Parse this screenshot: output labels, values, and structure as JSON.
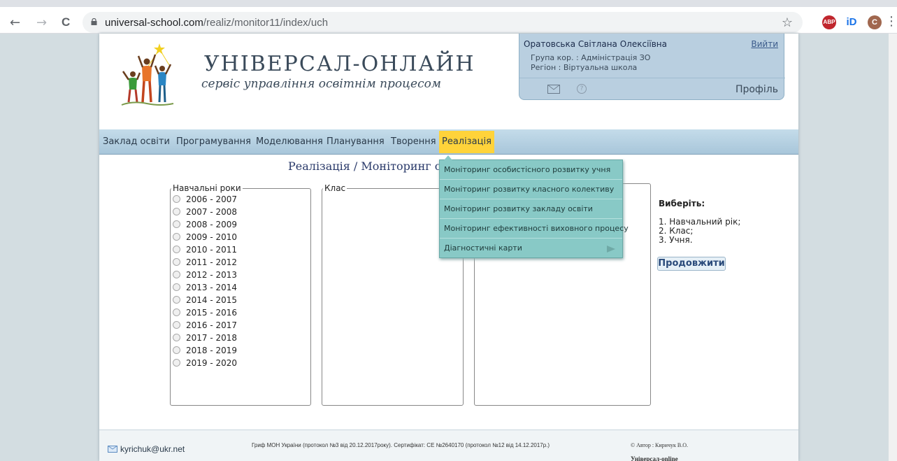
{
  "browser": {
    "url_host": "universal-school.com",
    "url_path": "/realiz/monitor11/index/uch",
    "back": "←",
    "forward": "→",
    "reload": "C",
    "star": "☆",
    "ext_abp": "ABP",
    "ext_id": "iD",
    "avatar": "C",
    "menu": "⋮"
  },
  "header": {
    "brand": "УНІВЕРСАЛ-ОНЛАЙН",
    "tagline": "сервіс управління освітнім процесом"
  },
  "user": {
    "name": "Оратовська Світлана Олексіївна",
    "logout": "Вийти",
    "group": "Група кор. : Адміністрація ЗО",
    "region": "Регіон : Віртуальна школа",
    "help": "?",
    "profile": "Профіль"
  },
  "menu": {
    "items": [
      "Заклад освіти",
      "Програмування",
      "Моделювання",
      "Планування",
      "Творення",
      "Реалізація"
    ]
  },
  "page_title": "Реалізація / Моніторинг о",
  "years_legend": "Навчальні роки",
  "class_legend": "Клас",
  "years": [
    "2006 - 2007",
    "2007 - 2008",
    "2008 - 2009",
    "2009 - 2010",
    "2010 - 2011",
    "2011 - 2012",
    "2012 - 2013",
    "2013 - 2014",
    "2014 - 2015",
    "2015 - 2016",
    "2016 - 2017",
    "2017 - 2018",
    "2018 - 2019",
    "2019 - 2020"
  ],
  "dropdown": {
    "items": [
      "Моніторинг особистісного розвитку учня",
      "Моніторинг розвитку класного колективу",
      "Моніторинг розвитку закладу освіти",
      "Моніторинг ефективності виховного процесу",
      "Діагностичні карти"
    ]
  },
  "hint": {
    "heading": "Виберіть:",
    "lines": [
      "1. Навчальний рік;",
      "2. Клас;",
      "3. Учня."
    ]
  },
  "continue_button": "Продовжити",
  "footer": {
    "email": "kyrichuk@ukr.net",
    "grif": "Гриф МОН України (протокол №3 від 20.12.2017року). Сертифікат: CE №2640170 (протокол №12 від 14.12.2017р.)",
    "author": "© Автор : Киричук В.О.",
    "project": "Універсал-online"
  }
}
